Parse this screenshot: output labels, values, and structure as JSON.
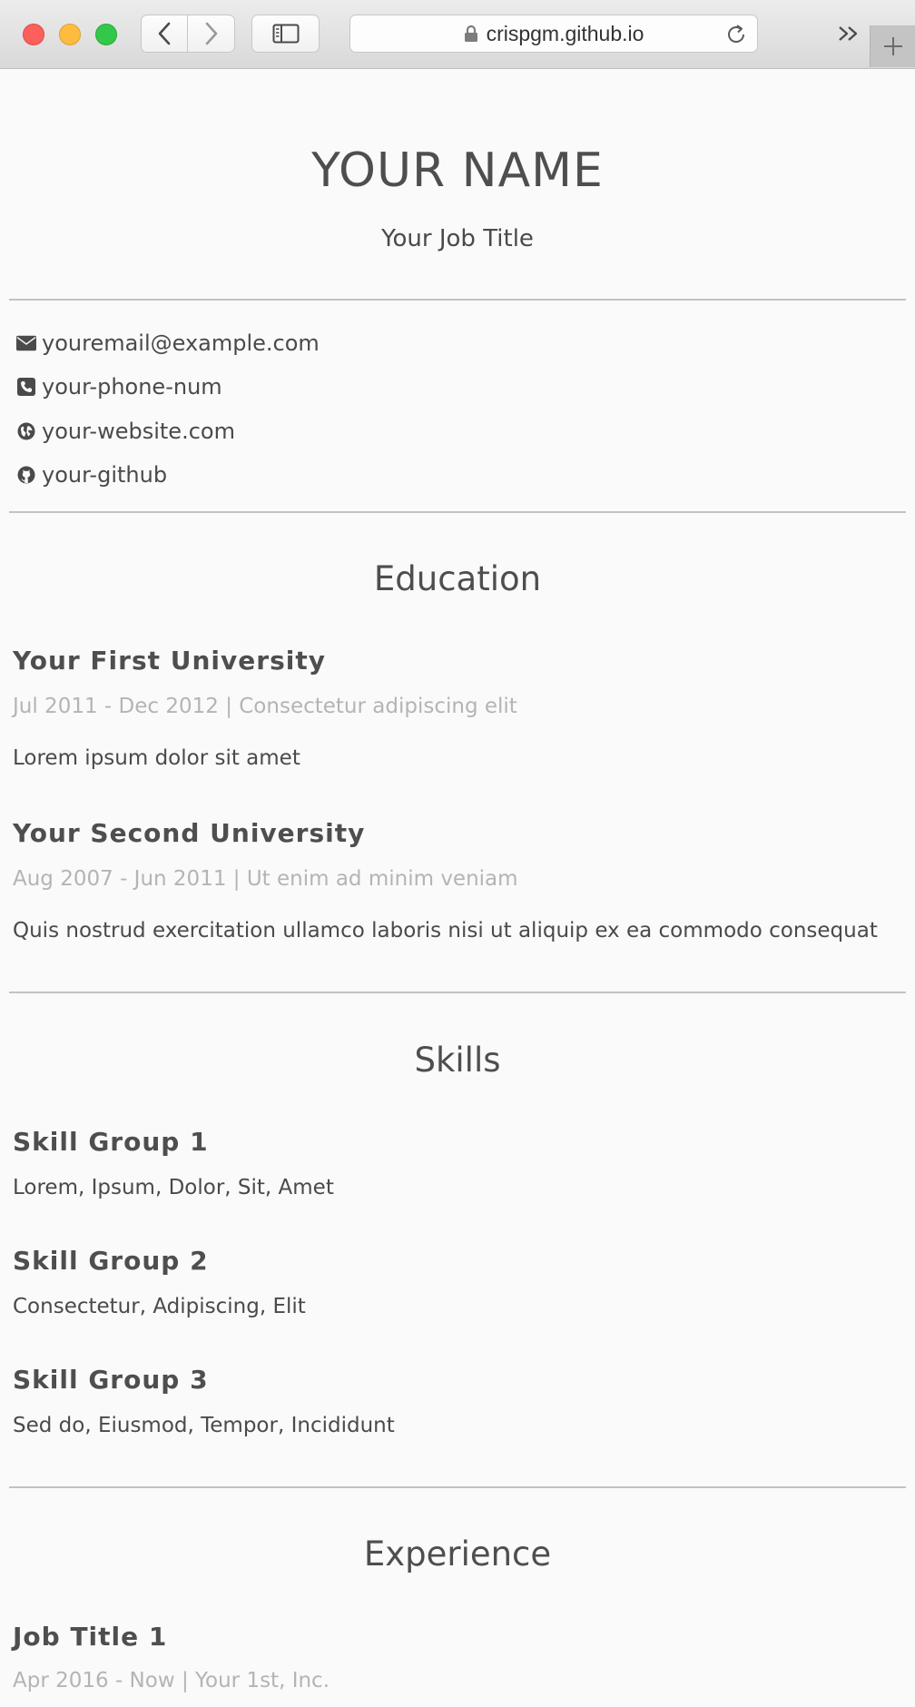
{
  "browser": {
    "url": "crispgm.github.io"
  },
  "header": {
    "name": "YOUR NAME",
    "job_title": "Your Job Title"
  },
  "contact": {
    "email": "youremail@example.com",
    "phone": "your-phone-num",
    "website": "your-website.com",
    "github": "your-github"
  },
  "education": {
    "title": "Education",
    "items": [
      {
        "school": "Your First University",
        "dates": "Jul 2011 - Dec 2012",
        "subtitle": "Consectetur adipiscing elit",
        "description": "Lorem ipsum dolor sit amet"
      },
      {
        "school": "Your Second University",
        "dates": "Aug 2007 - Jun 2011",
        "subtitle": "Ut enim ad minim veniam",
        "description": "Quis nostrud exercitation ullamco laboris nisi ut aliquip ex ea commodo consequat"
      }
    ]
  },
  "skills": {
    "title": "Skills",
    "groups": [
      {
        "name": "Skill Group 1",
        "list": "Lorem, Ipsum, Dolor, Sit, Amet"
      },
      {
        "name": "Skill Group 2",
        "list": "Consectetur, Adipiscing, Elit"
      },
      {
        "name": "Skill Group 3",
        "list": "Sed do, Eiusmod, Tempor, Incididunt"
      }
    ]
  },
  "experience": {
    "title": "Experience",
    "items": [
      {
        "title": "Job Title 1",
        "dates": "Apr 2016 - Now",
        "company": "Your 1st, Inc."
      }
    ]
  },
  "meta_separator": "|"
}
